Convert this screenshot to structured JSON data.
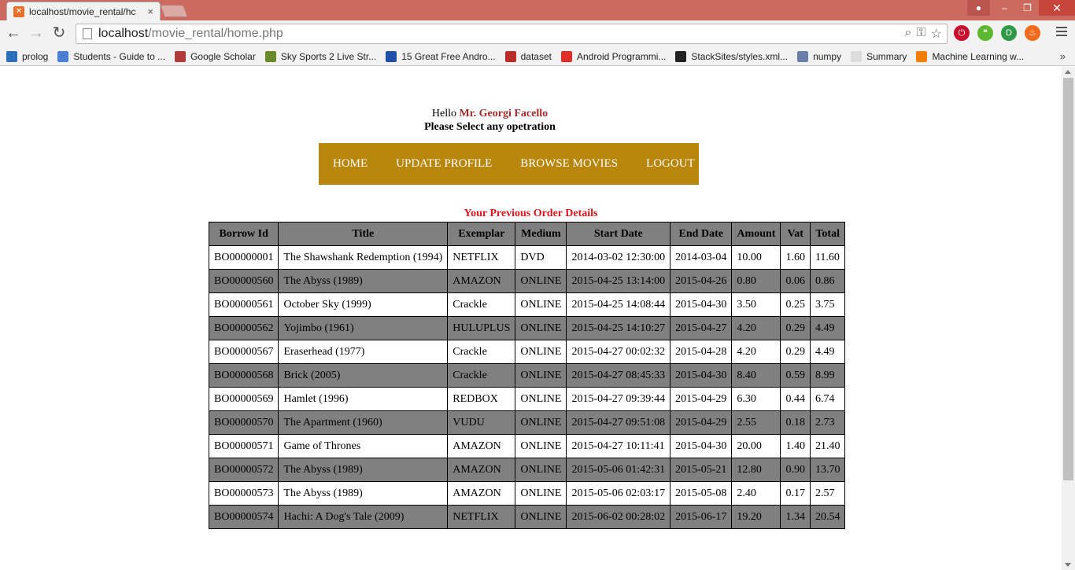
{
  "browser": {
    "tab_title": "localhost/movie_rental/hc",
    "tab_close": "×",
    "url_host": "localhost",
    "url_path": "/movie_rental/home.php",
    "window_buttons": {
      "minimize": "–",
      "maximize": "❐",
      "close": "✕"
    },
    "bookmarks": [
      {
        "label": "prolog",
        "icon": "snowflake-icon",
        "color": "#2a6fb8"
      },
      {
        "label": "Students - Guide to ...",
        "icon": "google-icon",
        "color": "#4a7fd6"
      },
      {
        "label": "Google Scholar",
        "icon": "scholar-icon",
        "color": "#b33a3a"
      },
      {
        "label": "Sky Sports 2 Live Str...",
        "icon": "check-icon",
        "color": "#6a8a2a"
      },
      {
        "label": "15 Great Free Andro...",
        "icon": "efy-icon",
        "color": "#1f4fa8"
      },
      {
        "label": "dataset",
        "icon": "quora-icon",
        "color": "#b92b27"
      },
      {
        "label": "Android Programmi...",
        "icon": "youtube-icon",
        "color": "#e52d27"
      },
      {
        "label": "StackSites/styles.xml...",
        "icon": "github-icon",
        "color": "#222222"
      },
      {
        "label": "numpy",
        "icon": "numpy-icon",
        "color": "#6b7fa8"
      },
      {
        "label": "Summary",
        "icon": "page-icon",
        "color": "#dddddd"
      },
      {
        "label": "Machine Learning w...",
        "icon": "blogger-icon",
        "color": "#f57d00"
      }
    ],
    "bookmarks_more": "»"
  },
  "page": {
    "greeting_prefix": "Hello",
    "user_name": "Mr. Georgi Facello",
    "instruction": "Please Select any opetration",
    "nav": [
      "HOME",
      "UPDATE PROFILE",
      "BROWSE MOVIES",
      "LOGOUT"
    ],
    "section_title": "Your Previous Order Details"
  },
  "orders": {
    "columns": [
      "Borrow Id",
      "Title",
      "Exemplar",
      "Medium",
      "Start Date",
      "End Date",
      "Amount",
      "Vat",
      "Total"
    ],
    "rows": [
      [
        "BO00000001",
        "The Shawshank Redemption (1994)",
        "NETFLIX",
        "DVD",
        "2014-03-02 12:30:00",
        "2014-03-04",
        "10.00",
        "1.60",
        "11.60"
      ],
      [
        "BO00000560",
        "The Abyss (1989)",
        "AMAZON",
        "ONLINE",
        "2015-04-25 13:14:00",
        "2015-04-26",
        "0.80",
        "0.06",
        "0.86"
      ],
      [
        "BO00000561",
        "October Sky (1999)",
        "Crackle",
        "ONLINE",
        "2015-04-25 14:08:44",
        "2015-04-30",
        "3.50",
        "0.25",
        "3.75"
      ],
      [
        "BO00000562",
        "Yojimbo (1961)",
        "HULUPLUS",
        "ONLINE",
        "2015-04-25 14:10:27",
        "2015-04-27",
        "4.20",
        "0.29",
        "4.49"
      ],
      [
        "BO00000567",
        "Eraserhead (1977)",
        "Crackle",
        "ONLINE",
        "2015-04-27 00:02:32",
        "2015-04-28",
        "4.20",
        "0.29",
        "4.49"
      ],
      [
        "BO00000568",
        "Brick (2005)",
        "Crackle",
        "ONLINE",
        "2015-04-27 08:45:33",
        "2015-04-30",
        "8.40",
        "0.59",
        "8.99"
      ],
      [
        "BO00000569",
        "Hamlet (1996)",
        "REDBOX",
        "ONLINE",
        "2015-04-27 09:39:44",
        "2015-04-29",
        "6.30",
        "0.44",
        "6.74"
      ],
      [
        "BO00000570",
        "The Apartment (1960)",
        "VUDU",
        "ONLINE",
        "2015-04-27 09:51:08",
        "2015-04-29",
        "2.55",
        "0.18",
        "2.73"
      ],
      [
        "BO00000571",
        "Game of Thrones",
        "AMAZON",
        "ONLINE",
        "2015-04-27 10:11:41",
        "2015-04-30",
        "20.00",
        "1.40",
        "21.40"
      ],
      [
        "BO00000572",
        "The Abyss (1989)",
        "AMAZON",
        "ONLINE",
        "2015-05-06 01:42:31",
        "2015-05-21",
        "12.80",
        "0.90",
        "13.70"
      ],
      [
        "BO00000573",
        "The Abyss (1989)",
        "AMAZON",
        "ONLINE",
        "2015-05-06 02:03:17",
        "2015-05-08",
        "2.40",
        "0.17",
        "2.57"
      ],
      [
        "BO00000574",
        "Hachi: A Dog's Tale (2009)",
        "NETFLIX",
        "ONLINE",
        "2015-06-02 00:28:02",
        "2015-06-17",
        "19.20",
        "1.34",
        "20.54"
      ]
    ]
  },
  "colors": {
    "nav_bg": "#b8860b",
    "user_name": "#a52a2a",
    "section_title": "#e0131a",
    "row_alt": "#808080",
    "titlebar": "#cc6a60"
  }
}
